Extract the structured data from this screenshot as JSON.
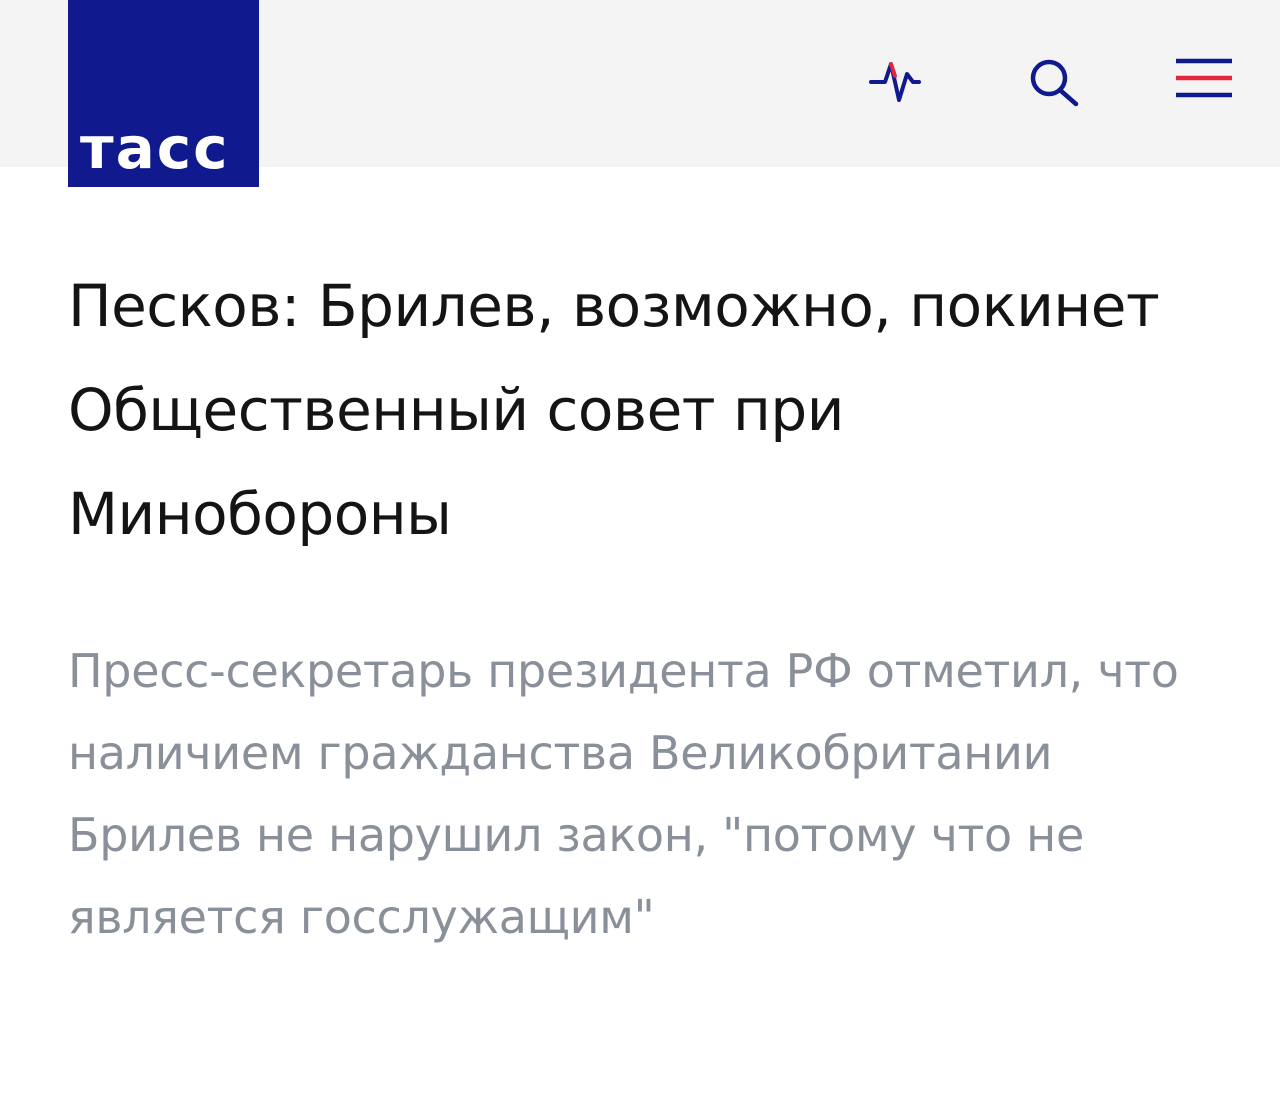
{
  "header": {
    "logo_text": "тасс",
    "icons": {
      "pulse": "pulse-icon",
      "search": "search-icon",
      "menu": "menu-icon"
    },
    "colors": {
      "brand": "#101a8e",
      "accent": "#e4253a",
      "header_bg": "#f4f4f4"
    }
  },
  "article": {
    "headline": "Песков: Брилев, возможно, покинет Общественный совет при Минобороны",
    "lead": "Пресс-секретарь президента РФ отметил, что наличием гражданства Великобритании Брилев не нарушил закон, \"потому что не является госслужащим\""
  }
}
